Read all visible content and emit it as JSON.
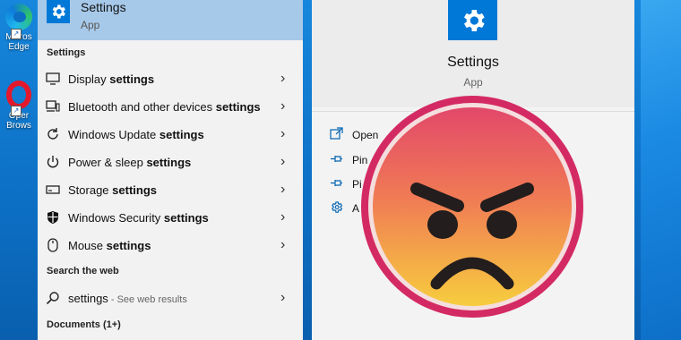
{
  "desktop": {
    "icons": [
      {
        "name": "edge",
        "label_line1": "Micros",
        "label_line2": "Edge"
      },
      {
        "name": "opera",
        "label_line1": "Oper",
        "label_line2": "Brows"
      }
    ]
  },
  "search_results": {
    "best_match": {
      "title": "Settings",
      "subtitle": "App",
      "icon": "gear-icon"
    },
    "section_settings": "Settings",
    "items": [
      {
        "pre": "Display ",
        "bold": "settings",
        "icon": "monitor-icon"
      },
      {
        "pre": "Bluetooth and other devices ",
        "bold": "settings",
        "icon": "devices-icon"
      },
      {
        "pre": "Windows Update ",
        "bold": "settings",
        "icon": "refresh-icon"
      },
      {
        "pre": "Power & sleep ",
        "bold": "settings",
        "icon": "power-icon"
      },
      {
        "pre": "Storage ",
        "bold": "settings",
        "icon": "storage-icon"
      },
      {
        "pre": "Windows Security ",
        "bold": "settings",
        "icon": "shield-icon"
      },
      {
        "pre": "Mouse ",
        "bold": "settings",
        "icon": "mouse-icon"
      }
    ],
    "section_web": "Search the web",
    "web_item": {
      "query": "settings",
      "hint": " - See web results",
      "icon": "search-icon"
    },
    "section_documents": "Documents (1+)"
  },
  "detail": {
    "app_name": "Settings",
    "app_type": "App",
    "actions": [
      {
        "label": "Open",
        "icon": "open-icon"
      },
      {
        "label": "Pin",
        "icon": "pin-icon"
      },
      {
        "label": "Pi",
        "icon": "pin-icon"
      },
      {
        "label": "A",
        "icon": "gear-icon"
      }
    ]
  },
  "overlay": {
    "emoji": "angry-face-emoji"
  },
  "colors": {
    "accent": "#0078d7",
    "selected": "#a7c9e9",
    "emoji_red": "#e2486a",
    "emoji_yellow": "#f5c23c",
    "emoji_border": "#d42a63"
  }
}
